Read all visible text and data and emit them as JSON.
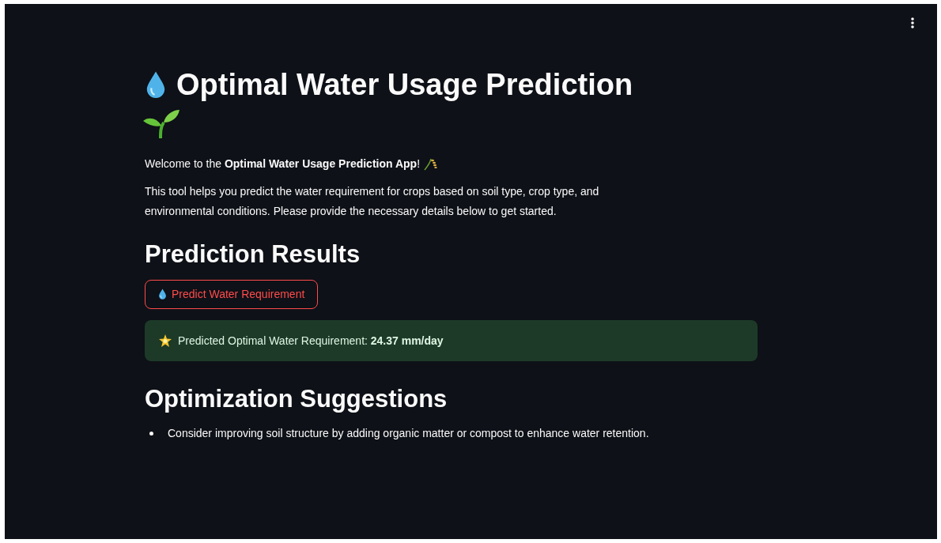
{
  "title": "Optimal Water Usage Prediction",
  "welcome": "Welcome to the **Optimal Water Usage Prediction App**!",
  "description": "This tool helps you predict the water requirement for crops based on soil type, crop type, and environmental conditions. Please provide the necessary details below to get started.",
  "results_heading": "Prediction Results",
  "predict_button": {
    "label": "Predict Water Requirement"
  },
  "result": {
    "kind": "success",
    "text": "Predicted Optimal Water Requirement: **24.37 mm/day**"
  },
  "suggestions_heading": "Optimization Suggestions",
  "suggestions": [
    "Consider improving soil structure by adding organic matter or compost to enhance water retention."
  ]
}
